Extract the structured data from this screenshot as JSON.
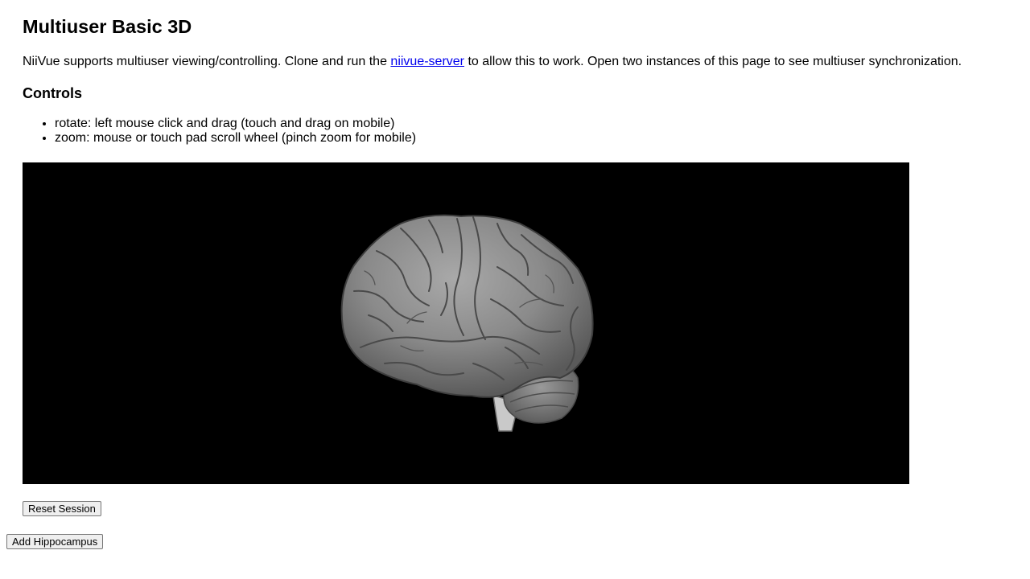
{
  "page": {
    "title": "Multiuser Basic 3D",
    "intro_before": "NiiVue supports multiuser viewing/controlling. Clone and run the ",
    "intro_link": "niivue-server",
    "intro_after": " to allow this to work. Open two instances of this page to see multiuser synchronization.",
    "controls_heading": "Controls",
    "controls": [
      "rotate: left mouse click and drag (touch and drag on mobile)",
      "zoom: mouse or touch pad scroll wheel (pinch zoom for mobile)"
    ]
  },
  "viewer": {
    "background": "#000000",
    "render": "3D brain volume rendering"
  },
  "buttons": {
    "reset_session": "Reset Session",
    "add_hippocampus": "Add Hippocampus"
  }
}
